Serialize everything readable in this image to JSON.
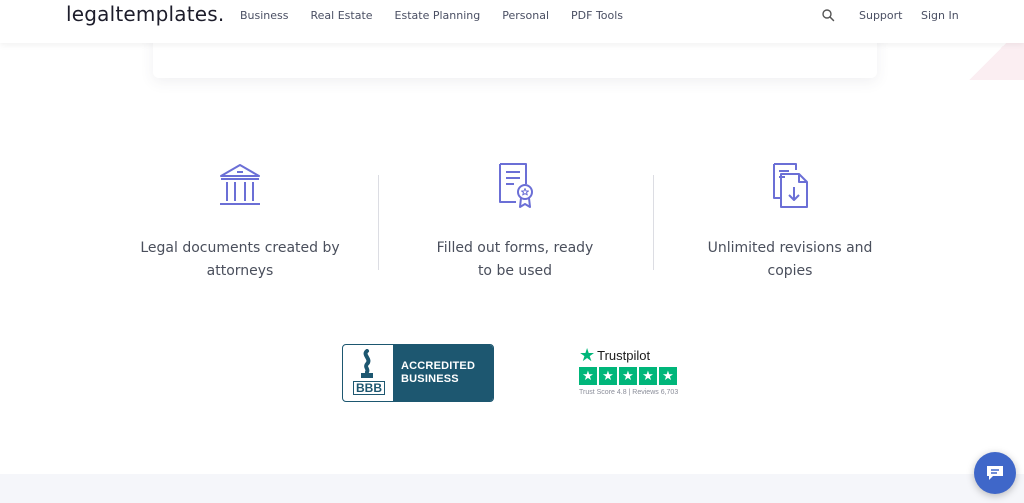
{
  "header": {
    "logo": "legaltemplates.",
    "nav": [
      "Business",
      "Real Estate",
      "Estate Planning",
      "Personal",
      "PDF Tools"
    ],
    "support": "Support",
    "signin": "Sign In"
  },
  "features": [
    {
      "icon": "bank-building-icon",
      "text": "Legal documents created by attorneys"
    },
    {
      "icon": "certificate-document-icon",
      "text": "Filled out forms, ready to be used"
    },
    {
      "icon": "document-download-icon",
      "text": "Unlimited revisions and copies"
    }
  ],
  "badges": {
    "bbb": {
      "mark": "BBB",
      "line1": "ACCREDITED",
      "line2": "BUSINESS"
    },
    "trustpilot": {
      "brand": "Trustpilot",
      "score_text": "Trust Score 4.8 | Reviews 6,703",
      "rating": 5
    }
  },
  "colors": {
    "accent": "#6b6fd6",
    "bbb": "#1d5770",
    "trustpilot": "#00b67a",
    "chat": "#3f67c9"
  }
}
